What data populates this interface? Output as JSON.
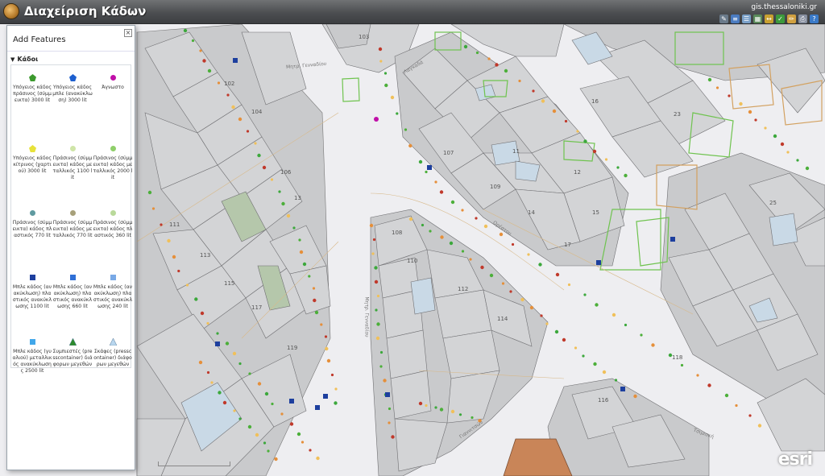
{
  "app": {
    "title": "Διαχείριση Κάδων",
    "site": "gis.thessaloniki.gr"
  },
  "toolbar": [
    "wrench-icon",
    "layers-icon",
    "list-icon",
    "table-icon",
    "measure-icon",
    "edit-icon",
    "pencil-icon",
    "print-icon",
    "help-icon"
  ],
  "panel": {
    "title": "Add Features",
    "layer": "Κάδοι",
    "items": [
      {
        "label": "Υπόγειος κάδος πράσινος (σύμμεικτα) 3000 lit",
        "shape": "pentagon",
        "color": "#3c9a2e"
      },
      {
        "label": "Υπόγειος κάδος μπλε (ανακύκλωση) 3000 lit",
        "shape": "pentagon",
        "color": "#1d5fcf"
      },
      {
        "label": "Άγνωστο",
        "shape": "circle",
        "color": "#c00fa8"
      },
      {
        "label": "Υπόγειος κάδος κίτρινος (χαρτιού) 3000 lit",
        "shape": "pentagon",
        "color": "#e7e23a"
      },
      {
        "label": "Πράσινος (σύμμεικτα) κάδος μεταλλικός 1100 lit",
        "shape": "circle",
        "color": "#cfe5a8"
      },
      {
        "label": "Πράσινος (σύμμεικτα) κάδος μεταλλικός 2000 lit",
        "shape": "circle",
        "color": "#8fcf6a"
      },
      {
        "label": "Πράσινος (σύμμεικτα) κάδος πλαστικός 770 lit",
        "shape": "circle",
        "color": "#5f9aa0"
      },
      {
        "label": "Πράσινος (σύμμεικτα) κάδος μεταλλικός 770 lit",
        "shape": "circle",
        "color": "#a7a07a"
      },
      {
        "label": "Πράσινος (σύμμεικτα) κάδος πλαστικός 360 lit",
        "shape": "circle",
        "color": "#b9d99a"
      },
      {
        "label": "Μπλε κάδος (ανακύκλωση) πλαστικός ανακύκλωσης 1100 lit",
        "shape": "square",
        "color": "#1d3f9e"
      },
      {
        "label": "Μπλε κάδος (ανακύκλωση) πλαστικός ανακύκλωσης 660 lit",
        "shape": "square",
        "color": "#2f6fd6"
      },
      {
        "label": "Μπλε κάδος (ανακύκλωση) πλαστικός ανακύκλωσης 240 lit",
        "shape": "square",
        "color": "#79a9e6"
      },
      {
        "label": "Μπλε κάδος (γυαλιού) μεταλλικός ανακύκλωσης 2500 lit",
        "shape": "square",
        "color": "#41a7ea"
      },
      {
        "label": "Συμπιεστές (presscontainer) διάφορων μεγεθών",
        "shape": "triangle",
        "color": "#2c8a2c"
      },
      {
        "label": "Σκάφες (presscontainer) διάφορων μεγεθών",
        "shape": "triangle",
        "color": "#b8d6ee"
      }
    ]
  },
  "map": {
    "roads": [
      "Μητρ. Γενναδίου",
      "Μητρ. Γενναδίου",
      "Λαγκαδά",
      "Ορέστου",
      "Γιαννιτσών",
      "Τσιμισκή"
    ],
    "parcels": [
      "103",
      "102",
      "104",
      "106",
      "111",
      "113",
      "115",
      "117",
      "119",
      "108",
      "107",
      "109",
      "110",
      "112",
      "114",
      "116",
      "118",
      "12",
      "13",
      "17",
      "11",
      "14",
      "15",
      "16",
      "23",
      "25"
    ],
    "attribution": "esri"
  }
}
